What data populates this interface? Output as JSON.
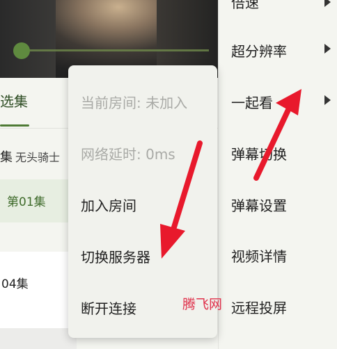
{
  "side_menu": {
    "items": [
      {
        "label": "倍速",
        "has_submenu": true
      },
      {
        "label": "超分辨率",
        "has_submenu": true
      },
      {
        "label": "一起看",
        "has_submenu": true
      },
      {
        "label": "弹幕切换",
        "has_submenu": false
      },
      {
        "label": "弹幕设置",
        "has_submenu": false
      },
      {
        "label": "视频详情",
        "has_submenu": false
      },
      {
        "label": "远程投屏",
        "has_submenu": false
      }
    ]
  },
  "episodes": {
    "tab_label": "选集",
    "current_title_prefix": "集",
    "current_title_name": "无头骑士",
    "ep1": "第01集",
    "ep4": "04集"
  },
  "popup": {
    "current_room": "当前房间: 未加入",
    "latency": "网络延时: 0ms",
    "join_room": "加入房间",
    "switch_server": "切换服务器",
    "disconnect": "断开连接"
  },
  "watermark": "腾飞网",
  "colors": {
    "accent": "#4e7a35",
    "annotation_arrow": "#e8192c",
    "disabled_text": "#a9aaa6"
  }
}
